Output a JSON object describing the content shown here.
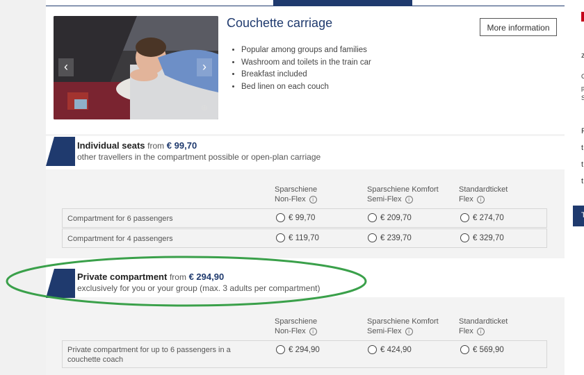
{
  "card": {
    "title": "Couchette carriage",
    "more_button": "More information",
    "features": [
      "Popular among groups and families",
      "Washroom and toilets in the train car",
      "Breakfast included",
      "Bed linen on each couch"
    ],
    "arrow_left": "‹",
    "arrow_right": "›",
    "zoom": "⊕"
  },
  "sections": [
    {
      "title": "Individual seats",
      "from_label": "from",
      "price": "€ 99,70",
      "subtitle": "other travellers in the compartment possible or open-plan carriage",
      "columns": [
        {
          "name": "Sparschiene",
          "sub": "Non-Flex"
        },
        {
          "name": "Sparschiene Komfort",
          "sub": "Semi-Flex"
        },
        {
          "name": "Standardticket",
          "sub": "Flex"
        }
      ],
      "rows": [
        {
          "label": "Compartment for 6 passengers",
          "prices": [
            "€ 99,70",
            "€ 209,70",
            "€ 274,70"
          ]
        },
        {
          "label": "Compartment for 4 passengers",
          "prices": [
            "€ 119,70",
            "€ 239,70",
            "€ 329,70"
          ]
        }
      ]
    },
    {
      "title": "Private compartment",
      "from_label": "from",
      "price": "€ 294,90",
      "subtitle": "exclusively for you or your group (max. 3 adults per compartment)",
      "columns": [
        {
          "name": "Sparschiene",
          "sub": "Non-Flex"
        },
        {
          "name": "Sparschiene Komfort",
          "sub": "Semi-Flex"
        },
        {
          "name": "Standardticket",
          "sub": "Flex"
        }
      ],
      "rows": [
        {
          "label_line1": "Private compartment for up to 6 passengers in a",
          "label_line2": "couchette coach",
          "prices": [
            "€ 294,90",
            "€ 424,90",
            "€ 569,90"
          ]
        }
      ]
    }
  ],
  "info_glyph": "i",
  "right_fragment": {
    "chars": [
      "z",
      "C",
      "p",
      "S",
      "F",
      "t",
      "t",
      "t",
      "T"
    ]
  },
  "colors": {
    "accent": "#1f3a6e",
    "highlight": "#3aa04a",
    "brand_red": "#c4001a"
  }
}
